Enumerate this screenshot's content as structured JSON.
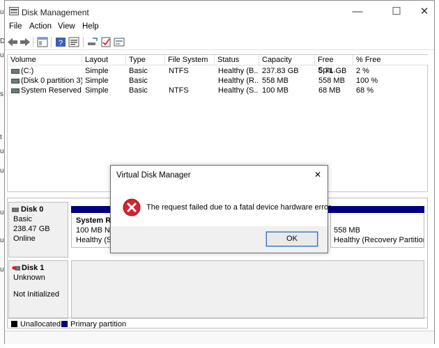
{
  "window": {
    "title": "Disk Management",
    "minimize": "—",
    "maximize": "☐",
    "close": "✕"
  },
  "menu": [
    "File",
    "Action",
    "View",
    "Help"
  ],
  "table": {
    "headers": [
      "Volume",
      "Layout",
      "Type",
      "File System",
      "Status",
      "Capacity",
      "Free Spa...",
      "% Free"
    ],
    "rows": [
      [
        "(C:)",
        "Simple",
        "Basic",
        "NTFS",
        "Healthy (B...",
        "237.83 GB",
        "5.71 GB",
        "2 %"
      ],
      [
        "(Disk 0 partition 3)",
        "Simple",
        "Basic",
        "",
        "Healthy (R...",
        "558 MB",
        "558 MB",
        "100 %"
      ],
      [
        "System Reserved",
        "Simple",
        "Basic",
        "NTFS",
        "Healthy (S...",
        "100 MB",
        "68 MB",
        "68 %"
      ]
    ]
  },
  "disks": [
    {
      "name": "Disk 0",
      "type": "Basic",
      "size": "238.47 GB",
      "state": "Online",
      "partitions": [
        {
          "name": "System Rese",
          "line2": "100 MB NTFS",
          "line3": "Healthy (Syst"
        },
        {
          "name": "",
          "line2": "558 MB",
          "line3": "Healthy (Recovery Partition)"
        }
      ]
    },
    {
      "name": "Disk 1",
      "type": "Unknown",
      "size": "",
      "state": "Not Initialized",
      "partitions": []
    }
  ],
  "legend": [
    {
      "label": "Unallocated",
      "color": "#000000"
    },
    {
      "label": "Primary partition",
      "color": "#000080"
    }
  ],
  "dialog": {
    "title": "Virtual Disk Manager",
    "close": "✕",
    "message": "The request failed due to a fatal device hardware error.",
    "ok": "OK"
  },
  "colors": {
    "primary_partition": "#000080",
    "error_red": "#d9232e"
  }
}
